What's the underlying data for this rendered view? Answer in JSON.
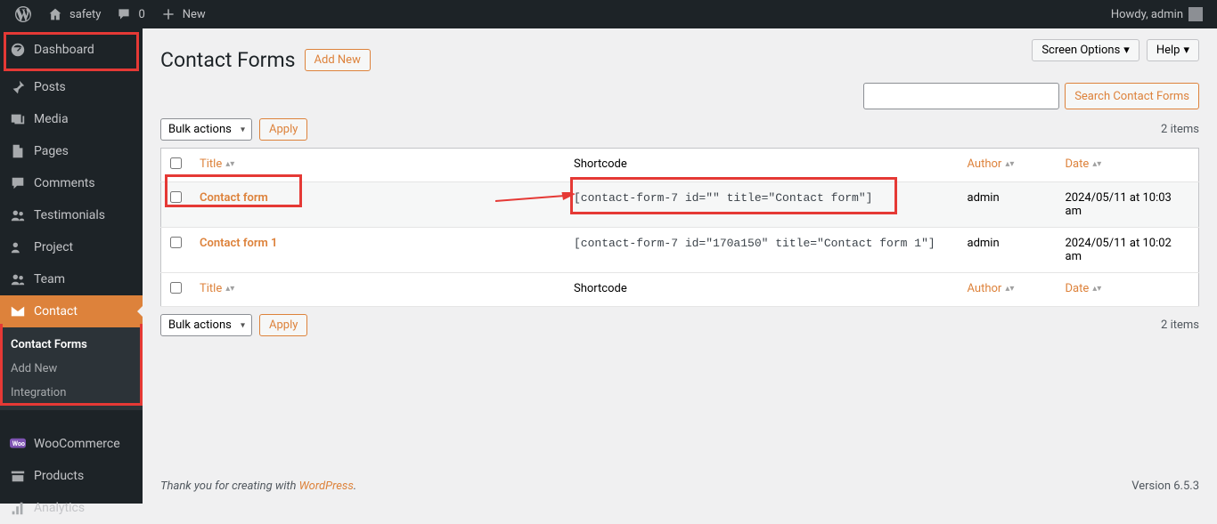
{
  "adminbar": {
    "site": "safety",
    "comments_count": "0",
    "new": "New",
    "howdy": "Howdy, admin"
  },
  "sidebar": {
    "items": [
      {
        "label": "Dashboard"
      },
      {
        "label": "Posts"
      },
      {
        "label": "Media"
      },
      {
        "label": "Pages"
      },
      {
        "label": "Comments"
      },
      {
        "label": "Testimonials"
      },
      {
        "label": "Project"
      },
      {
        "label": "Team"
      },
      {
        "label": "Contact"
      },
      {
        "label": "WooCommerce"
      },
      {
        "label": "Products"
      },
      {
        "label": "Analytics"
      }
    ],
    "submenu": [
      {
        "label": "Contact Forms"
      },
      {
        "label": "Add New"
      },
      {
        "label": "Integration"
      }
    ]
  },
  "page": {
    "title": "Contact Forms",
    "add_new": "Add New",
    "screen_options": "Screen Options",
    "help": "Help",
    "search_btn": "Search Contact Forms",
    "bulk_actions": "Bulk actions",
    "apply": "Apply",
    "items_count": "2 items",
    "columns": {
      "title": "Title",
      "shortcode": "Shortcode",
      "author": "Author",
      "date": "Date"
    },
    "rows": [
      {
        "title": "Contact form",
        "shortcode": "[contact-form-7 id=\"\" title=\"Contact form\"]",
        "author": "admin",
        "date": "2024/05/11 at 10:03 am"
      },
      {
        "title": "Contact form 1",
        "shortcode": "[contact-form-7 id=\"170a150\" title=\"Contact form 1\"]",
        "author": "admin",
        "date": "2024/05/11 at 10:02 am"
      }
    ]
  },
  "footer": {
    "thanks_pre": "Thank you for creating with ",
    "wp": "WordPress",
    "version": "Version 6.5.3"
  }
}
